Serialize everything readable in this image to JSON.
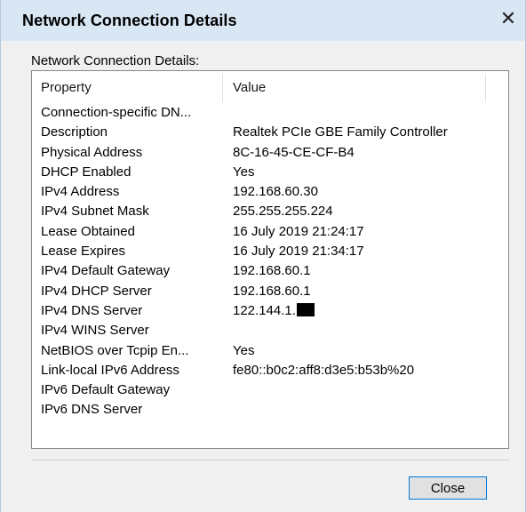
{
  "window": {
    "title": "Network Connection Details",
    "close_glyph": "✕"
  },
  "group_label": "Network Connection Details:",
  "table": {
    "columns": [
      "Property",
      "Value"
    ],
    "rows": [
      {
        "property": "Connection-specific DN...",
        "value": ""
      },
      {
        "property": "Description",
        "value": "Realtek PCIe GBE Family Controller"
      },
      {
        "property": "Physical Address",
        "value": "8C-16-45-CE-CF-B4"
      },
      {
        "property": "DHCP Enabled",
        "value": "Yes"
      },
      {
        "property": "IPv4 Address",
        "value": "192.168.60.30"
      },
      {
        "property": "IPv4 Subnet Mask",
        "value": "255.255.255.224"
      },
      {
        "property": "Lease Obtained",
        "value": "16 July 2019 21:24:17"
      },
      {
        "property": "Lease Expires",
        "value": "16 July 2019 21:34:17"
      },
      {
        "property": "IPv4 Default Gateway",
        "value": "192.168.60.1"
      },
      {
        "property": "IPv4 DHCP Server",
        "value": "192.168.60.1"
      },
      {
        "property": "IPv4 DNS Server",
        "value": "122.144.1."
      },
      {
        "property": "IPv4 WINS Server",
        "value": ""
      },
      {
        "property": "NetBIOS over Tcpip En...",
        "value": "Yes"
      },
      {
        "property": "Link-local IPv6 Address",
        "value": "fe80::b0c2:aff8:d3e5:b53b%20"
      },
      {
        "property": "IPv6 Default Gateway",
        "value": ""
      },
      {
        "property": "IPv6 DNS Server",
        "value": ""
      }
    ]
  },
  "buttons": {
    "close_label": "Close"
  }
}
